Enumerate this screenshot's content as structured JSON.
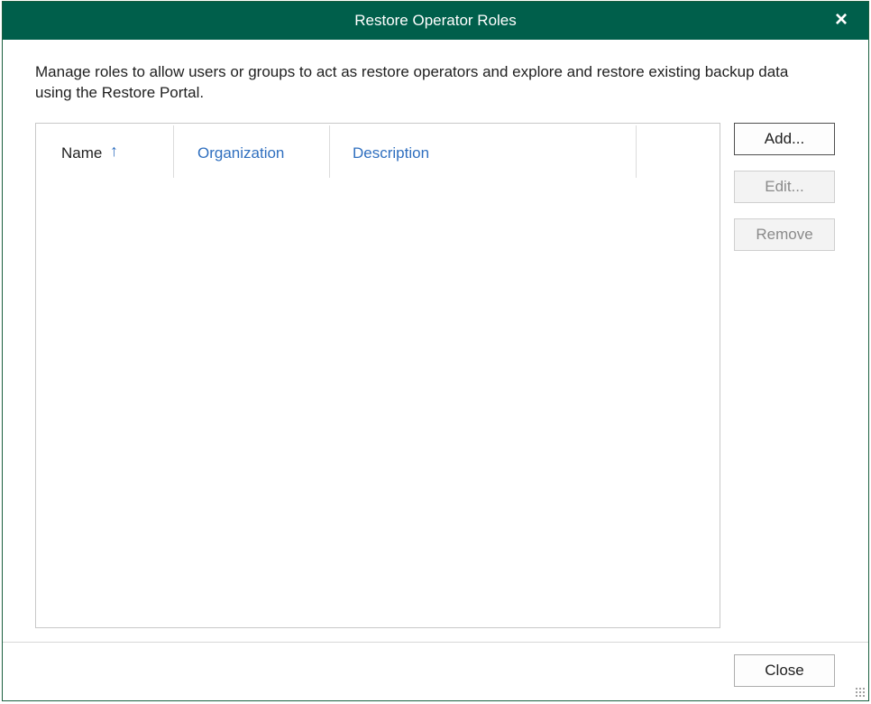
{
  "window": {
    "title": "Restore Operator Roles",
    "close_icon": "×"
  },
  "description": "Manage roles to allow users or groups to act as restore operators and explore and restore existing backup data using the Restore Portal.",
  "table": {
    "columns": [
      {
        "label": "Name",
        "sorted": "ascending",
        "sort_icon": "↑"
      },
      {
        "label": "Organization"
      },
      {
        "label": "Description"
      }
    ],
    "rows": []
  },
  "buttons": {
    "add": "Add...",
    "edit": "Edit...",
    "remove": "Remove",
    "close": "Close"
  },
  "colors": {
    "titlebar": "#005f4b",
    "link_header": "#2f6fbf"
  }
}
